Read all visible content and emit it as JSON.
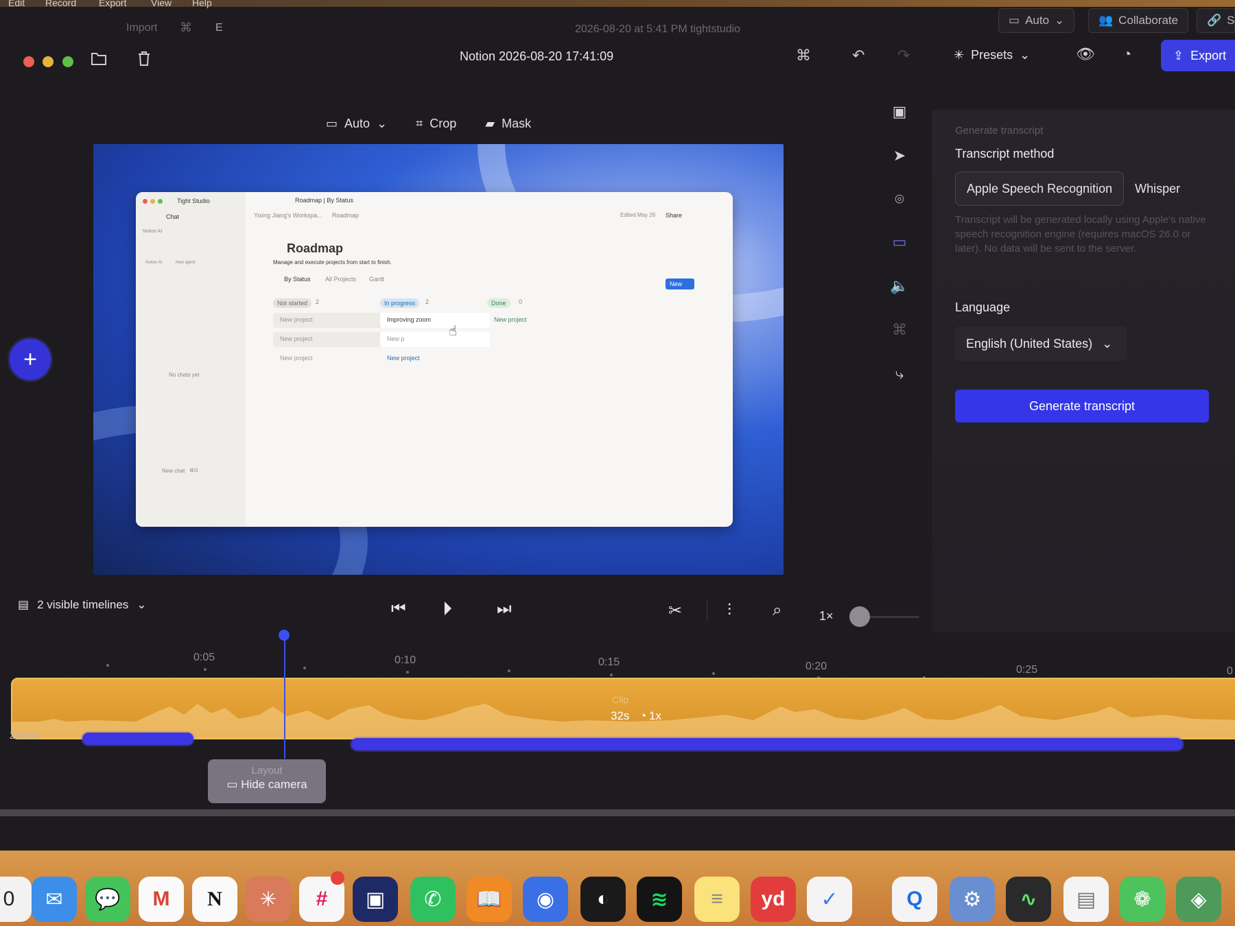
{
  "menubar": {
    "items": [
      "Edit",
      "Record",
      "Export",
      "View",
      "Help"
    ]
  },
  "subbar": {
    "left_item_1": "Import",
    "shortcut_glyph": "⌘",
    "shortcut_key": "E",
    "title": "2026-08-20 at 5:41 PM tightstudio",
    "auto_label": "Auto",
    "collaborate_label": "Collaborate",
    "share_label": "S"
  },
  "toolbar": {
    "doc_title": "Notion 2026-08-20 17:41:09",
    "presets_label": "Presets",
    "export_label": "Export"
  },
  "preview_tools": {
    "auto_label": "Auto",
    "crop_label": "Crop",
    "mask_label": "Mask"
  },
  "app_preview": {
    "window_title": "Tight Studio",
    "tab_title": "Roadmap | By Status",
    "chat_label": "Chat",
    "breadcrumb_1": "Yixing Jiang's Workspa...",
    "breadcrumb_2": "Roadmap",
    "edited": "Edited May 26",
    "share": "Share",
    "notion_ai": "Notion AI",
    "notion_ai_item": "Notion AI",
    "new_agent": "New agent",
    "no_chats": "No chats yet",
    "new_chat": "New chat",
    "new_chat_kbd": "⌘O",
    "page_title": "Roadmap",
    "page_desc": "Manage and execute projects from start to finish.",
    "views": [
      "By Status",
      "All Projects",
      "Gantt"
    ],
    "new_button": "New",
    "columns": [
      {
        "tag": "Not started",
        "count": "2",
        "cards": [
          "New project",
          "New project"
        ],
        "add": "New project"
      },
      {
        "tag": "In progress",
        "count": "2",
        "cards": [
          "Improving zoom",
          "New p"
        ],
        "add": "New project"
      },
      {
        "tag": "Done",
        "count": "0",
        "cards": [],
        "add": "New project"
      }
    ]
  },
  "panel": {
    "section": "Generate transcript",
    "method_label": "Transcript method",
    "methods": [
      "Apple Speech Recognition",
      "Whisper"
    ],
    "description": "Transcript will be generated locally using Apple's native speech recognition engine (requires macOS 26.0 or later). No data will be sent to the server.",
    "language_label": "Language",
    "language_value": "English (United States)",
    "generate_button": "Generate transcript"
  },
  "playback": {
    "visible_timelines": "2 visible timelines",
    "speed": "1×",
    "zoom_level": 0.0
  },
  "timeline": {
    "ticks": [
      "0:05",
      "0:10",
      "0:15",
      "0:20",
      "0:25",
      "0"
    ],
    "clip_label": "Clip",
    "clip_duration": "32s",
    "clip_speed": "1x",
    "zooms_label": "Zooms",
    "layout_label": "Layout",
    "layout_action": "Hide camera"
  },
  "dock": {
    "apps": [
      "Calendar",
      "Mail",
      "Messages",
      "Gmail",
      "Notion",
      "Claude",
      "Slack",
      "Finder",
      "WhatsApp",
      "Books",
      "Copilot",
      "Linear",
      "Spotify",
      "Notes",
      "Youdao",
      "Tasks",
      "QuickTime",
      "Automator",
      "Activity Monitor",
      "TextEdit",
      "WeChat",
      "Maps"
    ],
    "calendar_text": "0",
    "notion_text": "N",
    "youdao_text": "yd"
  },
  "colors": {
    "accent": "#3536e8",
    "clip": "#e3a136",
    "panel": "#26242a"
  }
}
